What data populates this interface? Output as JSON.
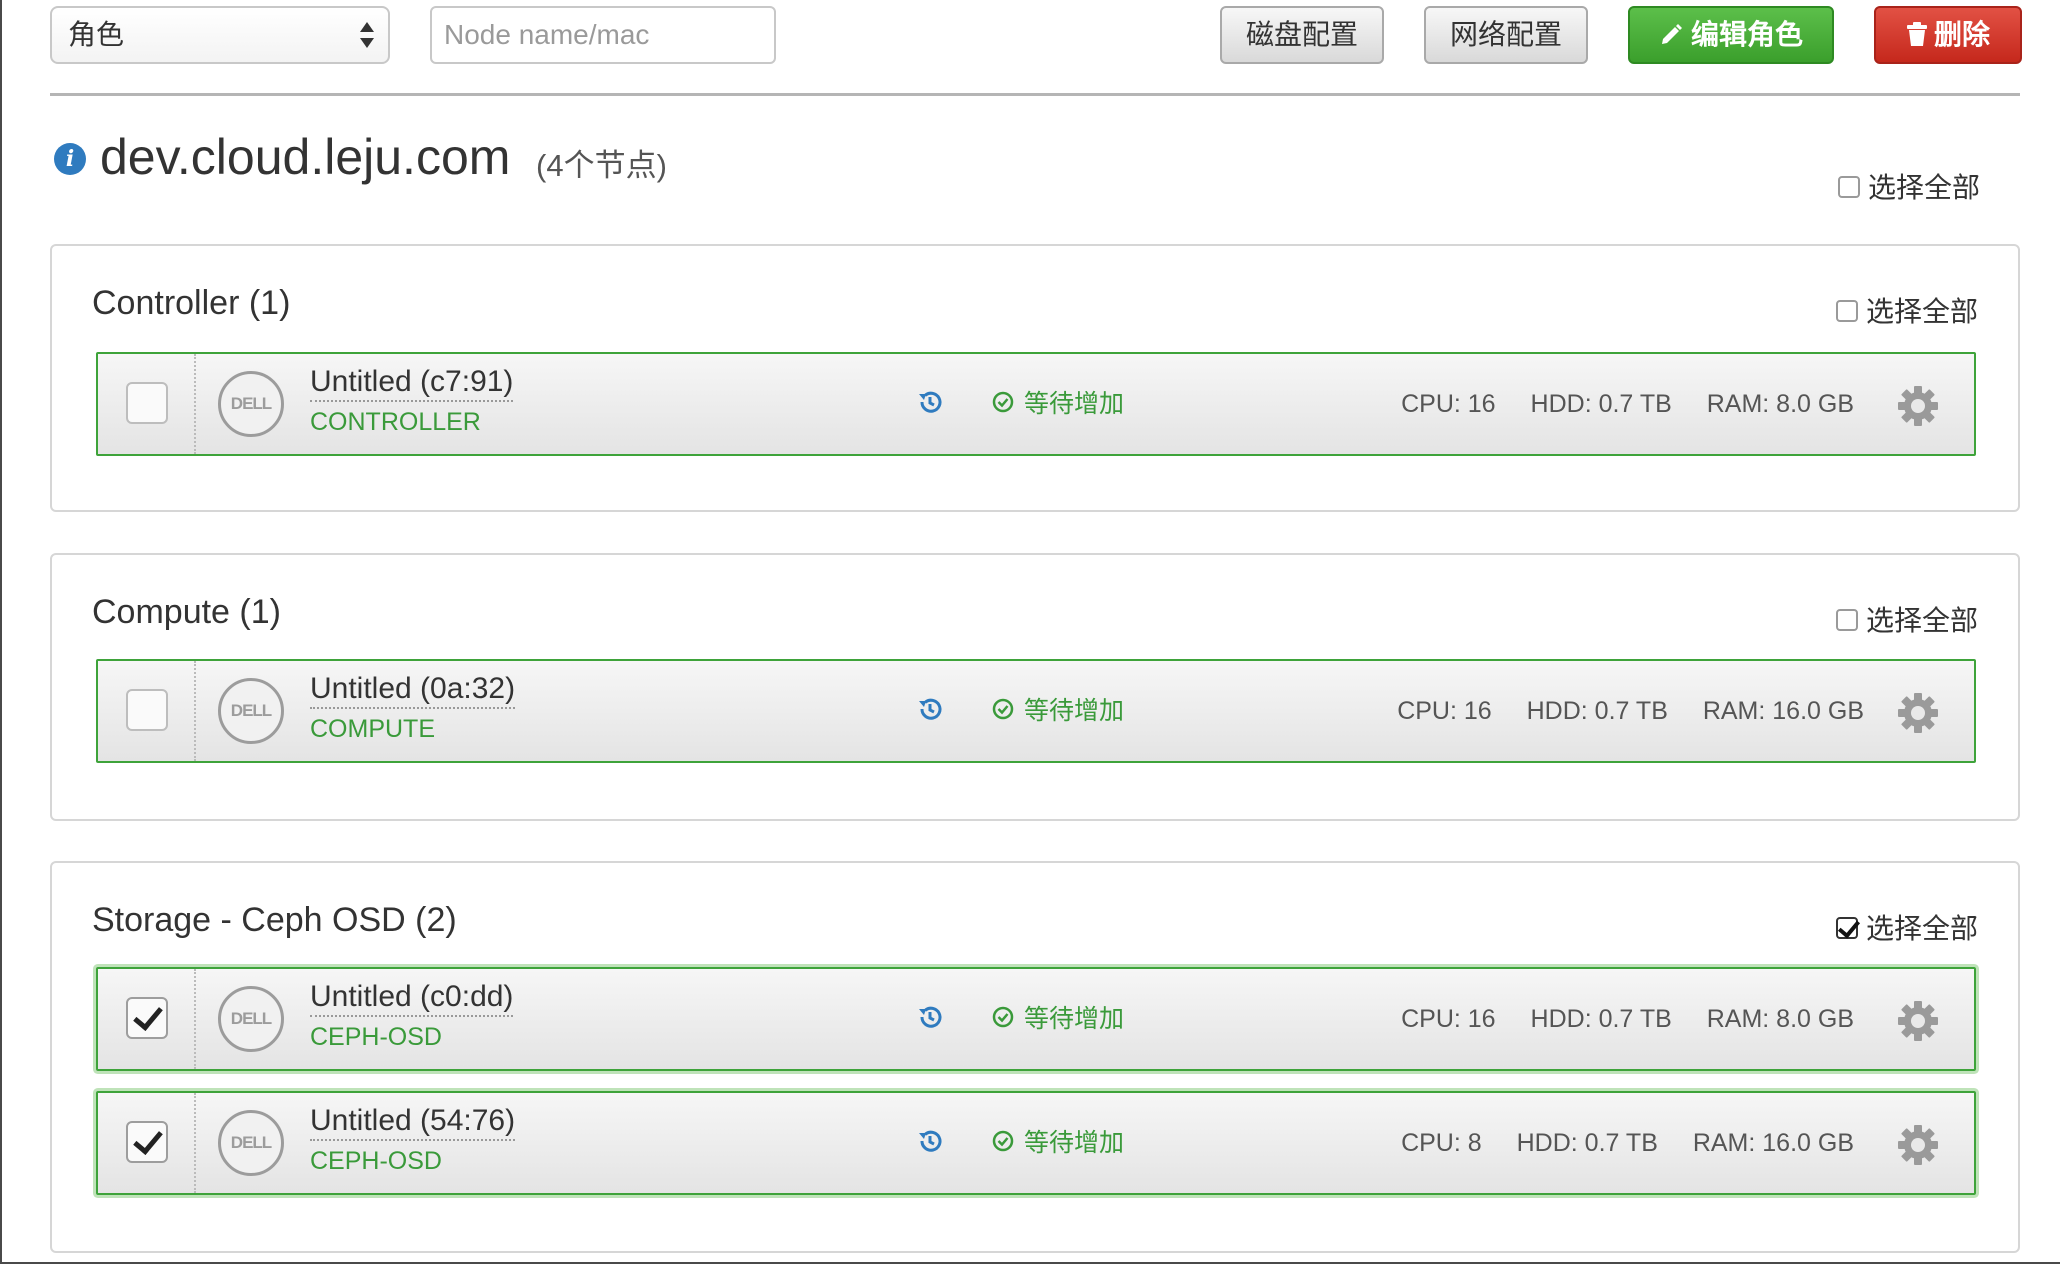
{
  "toolbar": {
    "role_select_value": "角色",
    "search_placeholder": "Node name/mac",
    "disk_config_label": "磁盘配置",
    "network_config_label": "网络配置",
    "edit_roles_label": "编辑角色",
    "delete_label": "删除"
  },
  "cluster": {
    "name": "dev.cloud.leju.com",
    "node_count": "(4个节点)",
    "select_all_label": "选择全部",
    "select_all_checked": false
  },
  "groups": [
    {
      "title": "Controller (1)",
      "select_all_label": "选择全部",
      "select_all_checked": false,
      "nodes": [
        {
          "name": "Untitled (c7:91)",
          "role": "CONTROLLER",
          "status": "等待增加",
          "cpu": "CPU: 16",
          "hdd": "HDD: 0.7 TB",
          "ram": "RAM: 8.0 GB",
          "checked": false,
          "logo": "DELL"
        }
      ]
    },
    {
      "title": "Compute (1)",
      "select_all_label": "选择全部",
      "select_all_checked": false,
      "nodes": [
        {
          "name": "Untitled (0a:32)",
          "role": "COMPUTE",
          "status": "等待增加",
          "cpu": "CPU: 16",
          "hdd": "HDD: 0.7 TB",
          "ram": "RAM: 16.0 GB",
          "checked": false,
          "logo": "DELL"
        }
      ]
    },
    {
      "title": "Storage - Ceph OSD (2)",
      "select_all_label": "选择全部",
      "select_all_checked": true,
      "nodes": [
        {
          "name": "Untitled (c0:dd)",
          "role": "CEPH-OSD",
          "status": "等待增加",
          "cpu": "CPU: 16",
          "hdd": "HDD: 0.7 TB",
          "ram": "RAM: 8.0 GB",
          "checked": true,
          "logo": "DELL"
        },
        {
          "name": "Untitled (54:76)",
          "role": "CEPH-OSD",
          "status": "等待增加",
          "cpu": "CPU: 8",
          "hdd": "HDD: 0.7 TB",
          "ram": "RAM: 16.0 GB",
          "checked": true,
          "logo": "DELL"
        }
      ]
    }
  ],
  "colors": {
    "accent_green": "#3ea33a",
    "edit_button": "#4cae3c",
    "delete_button": "#d33a2e",
    "info_blue": "#2f7bbf"
  },
  "icons": [
    "info-icon",
    "pencil-icon",
    "trash-icon",
    "history-icon",
    "check-circle-icon",
    "gear-icon",
    "dell-logo",
    "select-arrows-icon"
  ]
}
